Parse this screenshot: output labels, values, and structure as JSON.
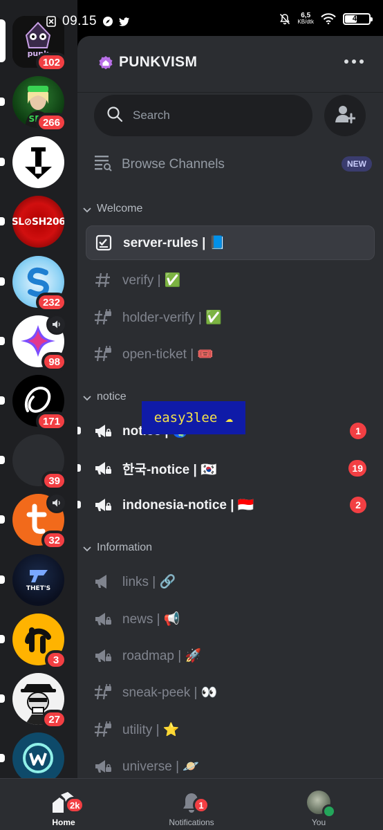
{
  "status_bar": {
    "time": "09.15",
    "net_speed_value": "6,5",
    "net_speed_unit": "KB/dtk",
    "battery": "49",
    "battery_level_pct": 49
  },
  "server_rail": {
    "servers": [
      {
        "name": "punkvism",
        "badge": "102",
        "unread": false
      },
      {
        "name": "sehati",
        "badge": "266",
        "unread": true
      },
      {
        "name": "nexus",
        "badge": "",
        "unread": true
      },
      {
        "name": "slash206",
        "logo_text": "SL⊘SH206",
        "badge": "",
        "unread": true
      },
      {
        "name": "s-blue",
        "badge": "232",
        "unread": true
      },
      {
        "name": "aurora",
        "badge": "98",
        "unread": true,
        "voice": true
      },
      {
        "name": "loop",
        "badge": "171",
        "unread": true
      },
      {
        "name": "dark",
        "badge": "39",
        "unread": true
      },
      {
        "name": "orange-t",
        "badge": "32",
        "unread": true,
        "voice": true
      },
      {
        "name": "thets",
        "logo_text": "THET'S",
        "badge": "",
        "unread": true
      },
      {
        "name": "yellow-lt",
        "badge": "3",
        "unread": true
      },
      {
        "name": "skull",
        "badge": "27",
        "unread": true
      },
      {
        "name": "w-logo",
        "badge": "",
        "unread": true
      }
    ]
  },
  "header": {
    "server_name": "PUNKVISM"
  },
  "search": {
    "placeholder": "Search"
  },
  "browse": {
    "label": "Browse Channels",
    "badge": "NEW"
  },
  "categories": [
    {
      "label": "Welcome"
    },
    {
      "label": "notice"
    },
    {
      "label": "Information"
    }
  ],
  "channels": [
    {
      "name": "server-rules | 📘",
      "type": "rules",
      "state": "active"
    },
    {
      "name": "verify | ✅",
      "type": "text",
      "state": "muted"
    },
    {
      "name": "holder-verify | ✅",
      "type": "text-lock",
      "state": "muted"
    },
    {
      "name": "open-ticket | 🎟️",
      "type": "text-lock",
      "state": "muted"
    },
    {
      "name": "notice | 🌏",
      "type": "announce",
      "state": "unread",
      "badge": "1"
    },
    {
      "name": "한국-notice | 🇰🇷",
      "type": "announce",
      "state": "unread",
      "badge": "19"
    },
    {
      "name": "indonesia-notice | 🇮🇩",
      "type": "announce",
      "state": "unread",
      "badge": "2"
    },
    {
      "name": "links | 🔗",
      "type": "announce",
      "state": "muted"
    },
    {
      "name": "news | 📢",
      "type": "announce",
      "state": "muted"
    },
    {
      "name": "roadmap | 🚀",
      "type": "announce",
      "state": "muted"
    },
    {
      "name": "sneak-peek | 👀",
      "type": "text-lock",
      "state": "muted"
    },
    {
      "name": "utility | ⭐",
      "type": "text-lock",
      "state": "muted"
    },
    {
      "name": "universe | 🪐",
      "type": "announce",
      "state": "muted"
    }
  ],
  "overlay": {
    "text": "easy3lee ☁"
  },
  "bottom_nav": {
    "home": {
      "label": "Home",
      "badge": "2k"
    },
    "notifications": {
      "label": "Notifications",
      "badge": "1"
    },
    "you": {
      "label": "You"
    }
  },
  "colors": {
    "accent_red": "#f23f43",
    "panel": "#2b2d31",
    "rail": "#1e1f22",
    "online": "#23a55a"
  }
}
